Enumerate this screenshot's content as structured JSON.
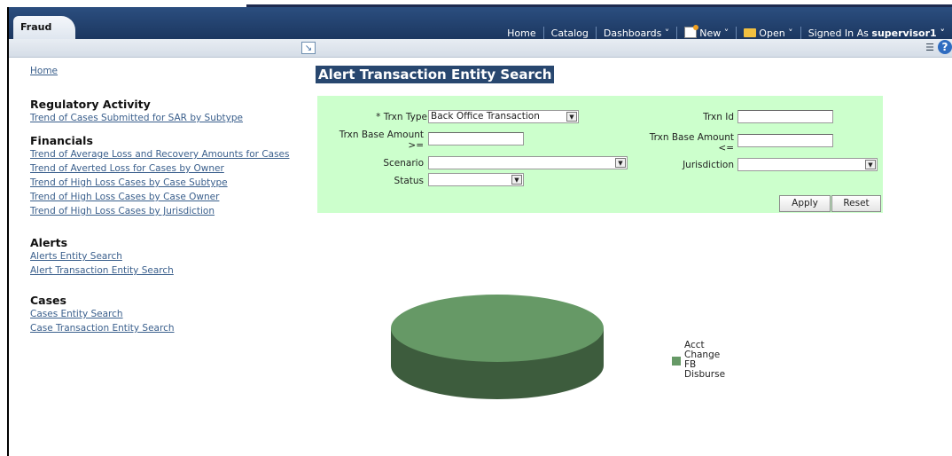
{
  "app": {
    "tab": "Fraud"
  },
  "nav": {
    "home": "Home",
    "catalog": "Catalog",
    "dashboards": "Dashboards ˅",
    "new": "New ˅",
    "open": "Open ˅",
    "signed_in_label": "Signed In As",
    "user": "supervisor1 ˅"
  },
  "sidebar": {
    "home_link": "Home",
    "sections": [
      {
        "title": "Regulatory Activity",
        "links": [
          "Trend of Cases Submitted for SAR by Subtype"
        ]
      },
      {
        "title": "Financials",
        "links": [
          "Trend of Average Loss and Recovery Amounts for Cases",
          "Trend of Averted Loss for Cases by Owner",
          "Trend of High Loss Cases by Case Subtype",
          "Trend of High Loss Cases by Case Owner",
          "Trend of High Loss Cases by Jurisdiction"
        ]
      },
      {
        "title": "Alerts",
        "links": [
          "Alerts Entity Search",
          "Alert Transaction Entity Search"
        ]
      },
      {
        "title": "Cases",
        "links": [
          "Cases Entity Search",
          "Case Transaction Entity Search"
        ]
      }
    ]
  },
  "page": {
    "title": "Alert Transaction Entity Search"
  },
  "filter": {
    "trxn_type_label": "* Trxn Type",
    "trxn_type_value": "Back Office Transaction",
    "trxn_id_label": "Trxn Id",
    "trxn_id_value": "",
    "base_amount_ge_label_1": "Trxn Base Amount",
    "base_amount_ge_label_2": ">=",
    "base_amount_ge_value": "",
    "base_amount_le_label_1": "Trxn Base Amount",
    "base_amount_le_label_2": "<=",
    "base_amount_le_value": "",
    "scenario_label": "Scenario",
    "scenario_value": "",
    "jurisdiction_label": "Jurisdiction",
    "jurisdiction_value": "",
    "status_label": "Status",
    "status_value": "",
    "apply": "Apply",
    "reset": "Reset"
  },
  "chart_data": {
    "type": "pie",
    "slices": [
      {
        "label": "Acct Change FB Disburse",
        "value": 100,
        "color": "#669966"
      }
    ],
    "legend": [
      "Acct",
      "Change",
      "FB",
      "Disburse"
    ],
    "legend_position": "right"
  },
  "colors": {
    "header": "#1c3760",
    "filter_bg": "#ccffcc",
    "title_bg": "#28476f",
    "pie_top": "#669966",
    "pie_side": "#3d5c3d"
  }
}
